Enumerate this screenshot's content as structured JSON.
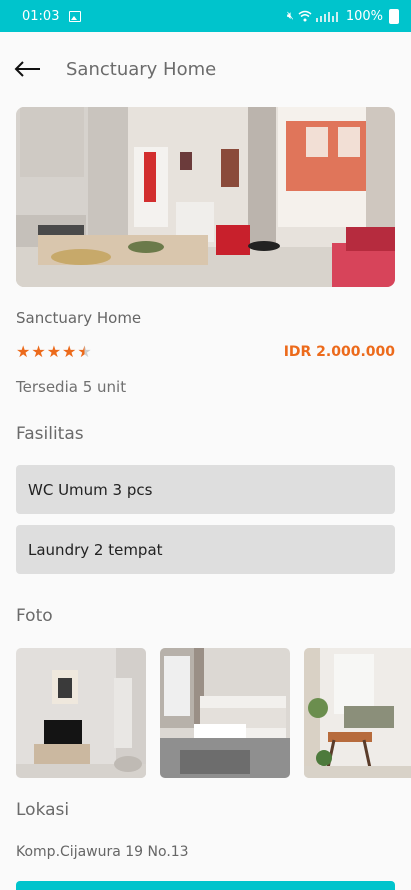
{
  "status": {
    "time": "01:03",
    "battery": "100%"
  },
  "header": {
    "title": "Sanctuary Home"
  },
  "property": {
    "name": "Sanctuary Home",
    "rating": 4.5,
    "price": "IDR 2.000.000",
    "availability": "Tersedia 5 unit"
  },
  "facilities": {
    "title": "Fasilitas",
    "items": [
      "WC Umum 3 pcs",
      "Laundry 2 tempat"
    ]
  },
  "photos": {
    "title": "Foto"
  },
  "location": {
    "title": "Lokasi",
    "address": "Komp.Cijawura 19 No.13"
  },
  "colors": {
    "accent": "#00c4cc",
    "price": "#ec6a1b",
    "star": "#ec6a1b"
  }
}
